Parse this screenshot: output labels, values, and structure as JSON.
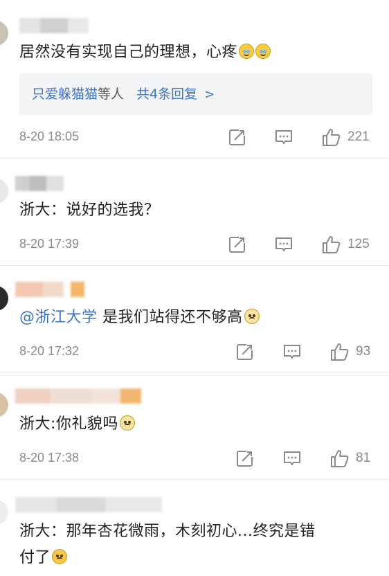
{
  "comments": [
    {
      "text": "居然没有实现自己的理想，心疼",
      "emoji": [
        "laugh-cry-emoji",
        "laugh-cry-emoji"
      ],
      "reply_summary": {
        "names": "只爱躲猫猫",
        "mid": "等人",
        "count_text": "共4条回复"
      },
      "time": "8-20 18:05",
      "likes": "221"
    },
    {
      "text": "浙大：说好的选我？",
      "time": "8-20 17:39",
      "likes": "125"
    },
    {
      "mention": "@浙江大学",
      "text": " 是我们站得还不够高",
      "emoji": [
        "sad-emoji"
      ],
      "time": "8-20 17:32",
      "likes": "93"
    },
    {
      "text": "浙大:你礼貌吗",
      "emoji": [
        "sad-emoji"
      ],
      "time": "8-20 17:38",
      "likes": "81"
    },
    {
      "text_line1": "浙大：那年杏花微雨，木刻初心...终究是错",
      "text_line2": "付了",
      "emoji": [
        "shy-emoji"
      ]
    }
  ],
  "colors": {
    "link": "#3b73c7",
    "meta": "#8a8a8a",
    "reply_bg": "#f3f4f6"
  }
}
